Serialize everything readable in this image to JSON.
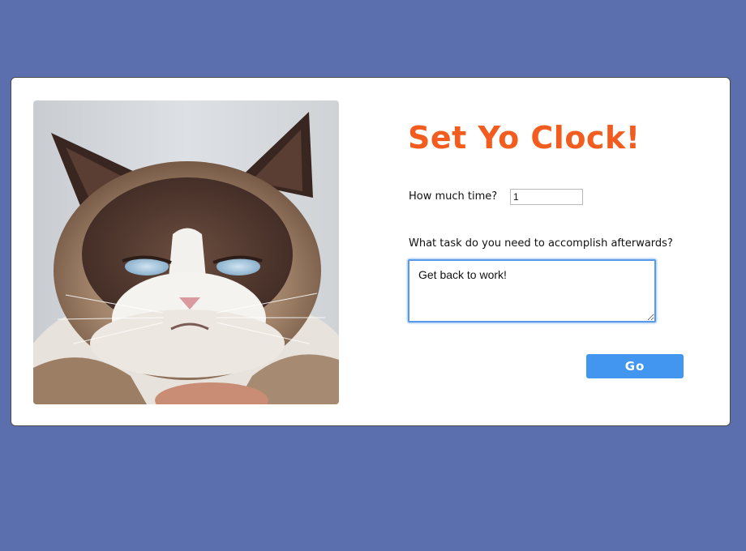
{
  "colors": {
    "background": "#5b6eae",
    "card": "#ffffff",
    "title": "#f25c1e",
    "button": "#4296f0"
  },
  "image": {
    "subject": "grumpy-cat-photo"
  },
  "form": {
    "title": "Set Yo Clock!",
    "time_label": "How much time?",
    "time_value": "1",
    "task_label": "What task do you need to accomplish afterwards?",
    "task_value": "Get back to work!",
    "go_label": "Go"
  }
}
